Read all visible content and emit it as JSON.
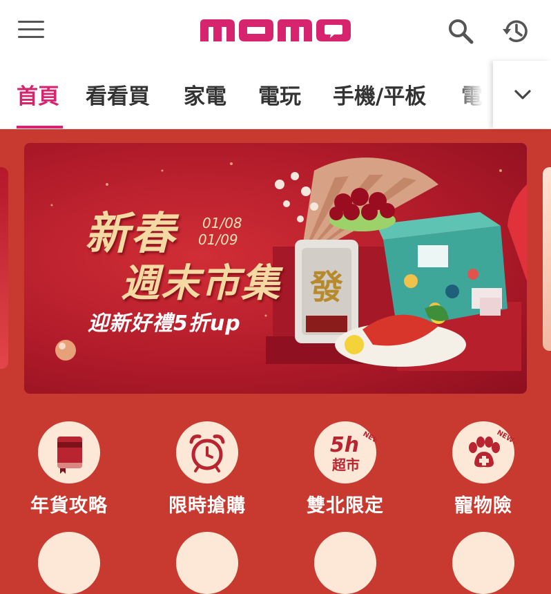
{
  "header": {
    "logo_text": "momo",
    "brand_color": "#d6246e",
    "icons": [
      "menu-icon",
      "search-icon",
      "history-icon"
    ]
  },
  "tabs": [
    {
      "label": "首頁",
      "active": true
    },
    {
      "label": "看看買",
      "active": false
    },
    {
      "label": "家電",
      "active": false
    },
    {
      "label": "電玩",
      "active": false
    },
    {
      "label": "手機/平板",
      "active": false
    },
    {
      "label": "電腦",
      "active": false
    }
  ],
  "banner": {
    "title_line1": "新春",
    "title_line2": "週末市集",
    "date1": "01/08",
    "date2": "01/09",
    "subtitle": "迎新好禮5折up",
    "box_mark": "發"
  },
  "shortcuts": [
    {
      "label": "年貨攻略",
      "icon": "book-icon"
    },
    {
      "label": "限時搶購",
      "icon": "alarm-clock-icon"
    },
    {
      "label": "雙北限定",
      "icon": "5h-supermarket-icon",
      "badge": "NEW!",
      "icon_text": "5h",
      "icon_subtext": "超市"
    },
    {
      "label": "寵物險",
      "icon": "paw-icon",
      "badge": "NEW!"
    }
  ]
}
